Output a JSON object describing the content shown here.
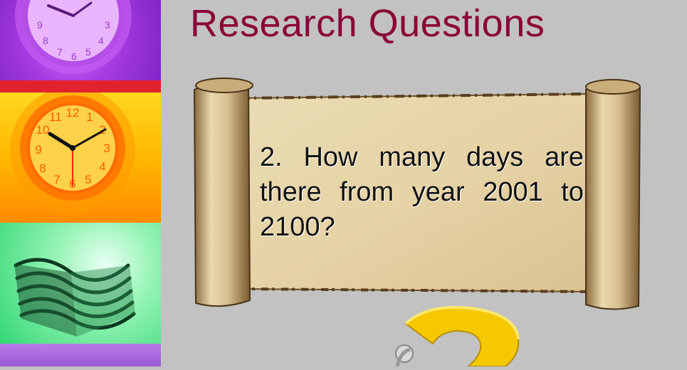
{
  "slide": {
    "title": "Research Questions",
    "question": "2. How many days are there from year 2001 to 2100?"
  },
  "colors": {
    "title": "#8c0037",
    "background": "#c2c2c2",
    "parchment": "#e6d7ae",
    "question_mark": "#f5c800"
  },
  "icons": [
    "clock-icon",
    "alarm-clock-icon",
    "book-icon",
    "parchment-scroll-icon",
    "question-mark-icon"
  ]
}
